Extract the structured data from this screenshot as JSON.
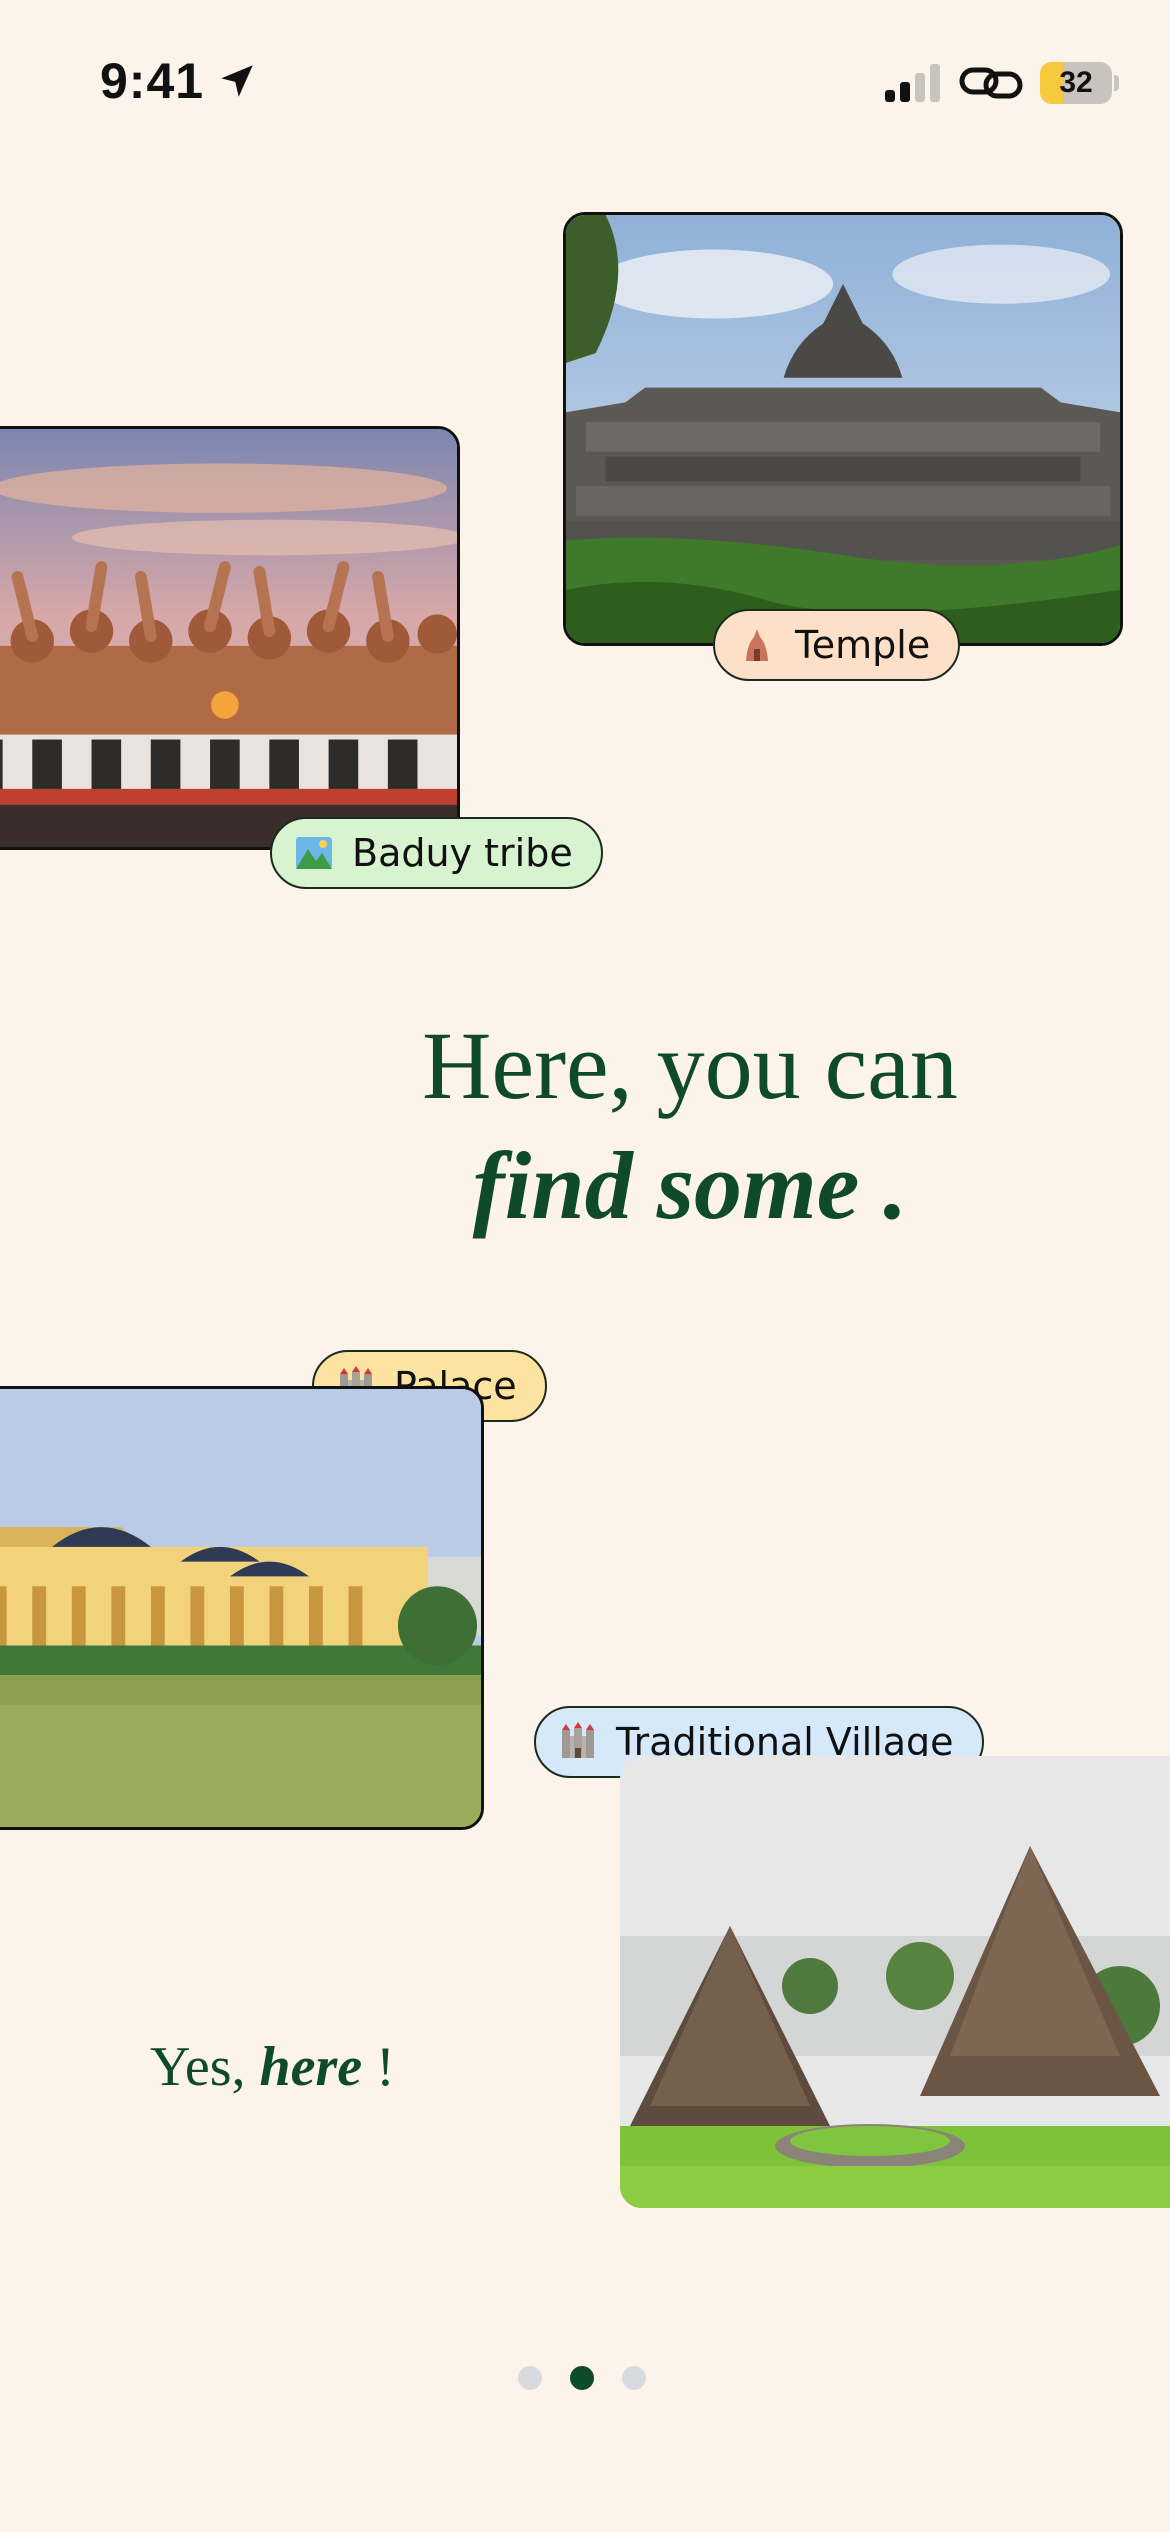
{
  "status_bar": {
    "time": "9:41",
    "battery_level": "32",
    "battery_fraction": 0.32,
    "icons": [
      "location-arrow-icon",
      "signal-icon",
      "link-icon",
      "battery-icon"
    ]
  },
  "cards": [
    {
      "name": "temple",
      "label": "Temple",
      "pill_color": "#fde0c7",
      "emoji": "temple-icon"
    },
    {
      "name": "baduy-tribe",
      "label": "Baduy tribe",
      "pill_color": "#d7f3cf",
      "emoji": "landscape-icon"
    },
    {
      "name": "palace",
      "label": "Palace",
      "pill_color": "#fde3a0",
      "emoji": "castle-icon"
    },
    {
      "name": "traditional-village",
      "label": "Traditional Village",
      "pill_color": "#d6e9fb",
      "emoji": "castle-icon"
    }
  ],
  "headline": {
    "line1": "Here, you can",
    "line2": "find some ."
  },
  "note": {
    "prefix": "Yes, ",
    "emphasis": "here",
    "suffix": " !"
  },
  "pagination": {
    "count": 3,
    "active_index": 1
  },
  "colors": {
    "background": "#fcf3ea",
    "accent": "#0f4a2a"
  }
}
